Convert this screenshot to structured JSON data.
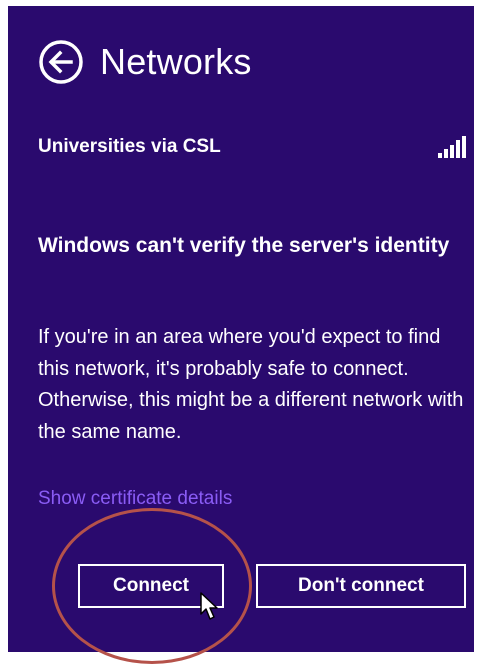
{
  "header": {
    "title": "Networks",
    "back_icon": "back-arrow-circle-icon"
  },
  "network": {
    "name": "Universities via CSL",
    "signal_icon": "wifi-signal-bars-icon",
    "signal_strength": "full"
  },
  "warning": {
    "title": "Windows can't verify the server's identity",
    "body": "If you're in an area where you'd expect to find this network, it's probably safe to connect. Otherwise, this might be a different network with the same name."
  },
  "links": {
    "certificate": "Show certificate details"
  },
  "buttons": {
    "connect": "Connect",
    "dont_connect": "Don't connect"
  },
  "colors": {
    "panel_background": "#2a0a6e",
    "text": "#ffffff",
    "link": "#8a5cf5",
    "annotation_circle": "#b5524a"
  },
  "annotation": {
    "highlight_target": "Connect"
  }
}
